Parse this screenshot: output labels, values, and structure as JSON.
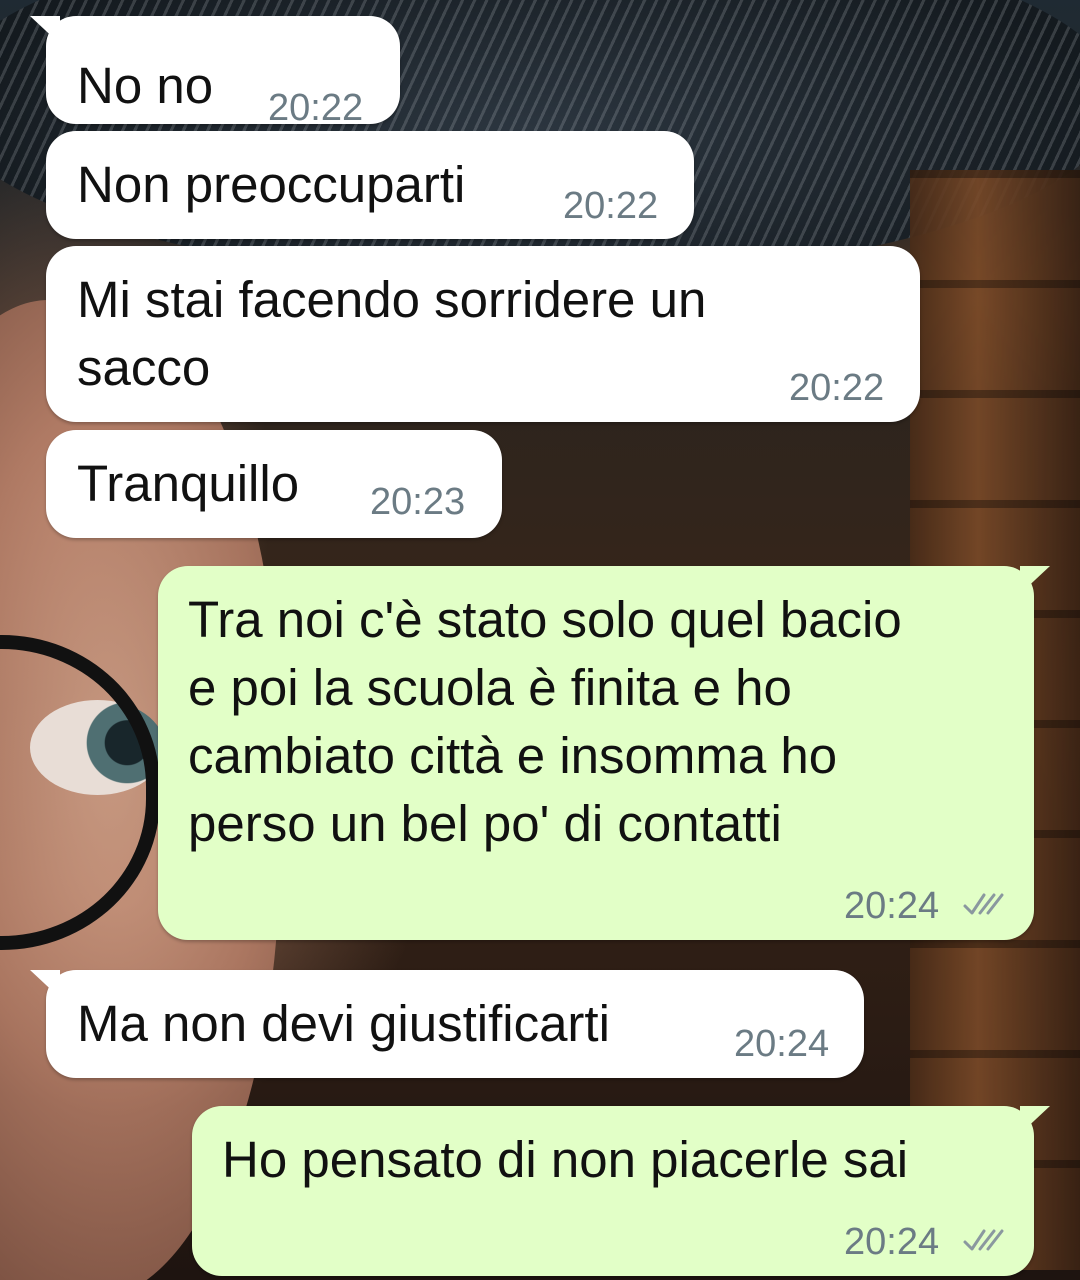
{
  "messages": [
    {
      "direction": "incoming",
      "text": "No no",
      "time": "20:22"
    },
    {
      "direction": "incoming",
      "text": "Non preoccuparti",
      "time": "20:22"
    },
    {
      "direction": "incoming",
      "lines": [
        "Mi stai facendo sorridere un",
        "sacco"
      ],
      "time": "20:22"
    },
    {
      "direction": "incoming",
      "text": "Tranquillo",
      "time": "20:23"
    },
    {
      "direction": "outgoing",
      "lines": [
        "Tra noi c'è stato solo quel bacio",
        "e poi la scuola è finita e ho",
        "cambiato città e insomma ho",
        "perso un bel po' di contatti"
      ],
      "time": "20:24",
      "status": "read-double-check-icon"
    },
    {
      "direction": "incoming",
      "text": "Ma non devi giustificarti",
      "time": "20:24"
    },
    {
      "direction": "outgoing",
      "text": "Ho pensato di non piacerle sai",
      "time": "20:24",
      "status": "read-double-check-icon"
    }
  ],
  "colors": {
    "incoming_bubble": "#ffffff",
    "outgoing_bubble": "#e2ffc7",
    "timestamp": "#6b7b84",
    "check_marks": "#8a989f"
  }
}
